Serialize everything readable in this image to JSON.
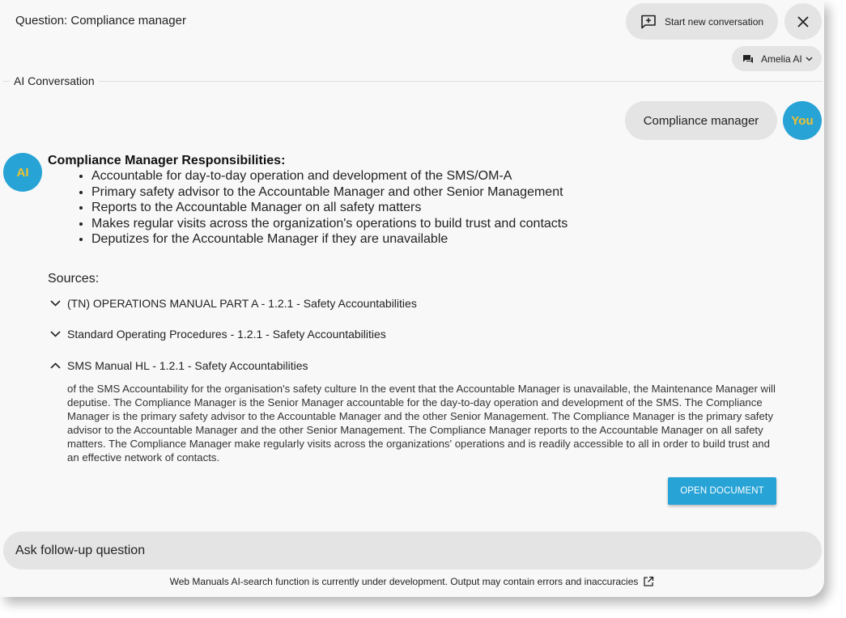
{
  "header": {
    "question_label": "Question: Compliance manager",
    "new_conversation_label": "Start new conversation",
    "model_selector": "Amelia AI"
  },
  "section_label": "AI Conversation",
  "user_message": {
    "text": "Compliance manager",
    "avatar": "You"
  },
  "ai_message": {
    "avatar": "AI",
    "heading": "Compliance Manager Responsibilities:",
    "bullets": [
      "Accountable for day-to-day operation and development of the SMS/OM-A",
      "Primary safety advisor to the Accountable Manager and other Senior Management",
      "Reports to the Accountable Manager on all safety matters",
      "Makes regular visits across the organization's operations to build trust and contacts",
      "Deputizes for the Accountable Manager if they are unavailable"
    ]
  },
  "sources": {
    "title": "Sources:",
    "items": [
      {
        "label": "(TN) OPERATIONS MANUAL PART A - 1.2.1 - Safety Accountabilities",
        "expanded": false
      },
      {
        "label": "Standard Operating Procedures - 1.2.1 - Safety Accountabilities",
        "expanded": false
      },
      {
        "label": "SMS Manual HL - 1.2.1 - Safety Accountabilities",
        "expanded": true
      }
    ],
    "excerpt": "of the SMS Accountability for the organisation's safety culture In the event that the Accountable Manager is unavailable, the Maintenance Manager will deputise. The Compliance Manager is the Senior Manager accountable for the day-to-day operation and development of the SMS.  The Compliance Manager is the primary safety advisor to the Accountable Manager and the other Senior Management. The Compliance Manager is the primary safety advisor to the Accountable Manager and the other Senior Management.  The Compliance Manager reports to the Accountable Manager on all safety matters. The Compliance Manager make regularly visits across the organizations' operations and is readily accessible to all in order to build trust and an effective network of contacts.",
    "open_button": "OPEN DOCUMENT"
  },
  "followup": {
    "placeholder": "Ask follow-up question"
  },
  "disclaimer": "Web Manuals AI-search function is currently under development. Output may contain errors and inaccuracies",
  "colors": {
    "accent": "#27a3d6",
    "avatar_text": "#f2c230",
    "bubble": "#e4e4e4",
    "panel": "#f8f8f8"
  }
}
